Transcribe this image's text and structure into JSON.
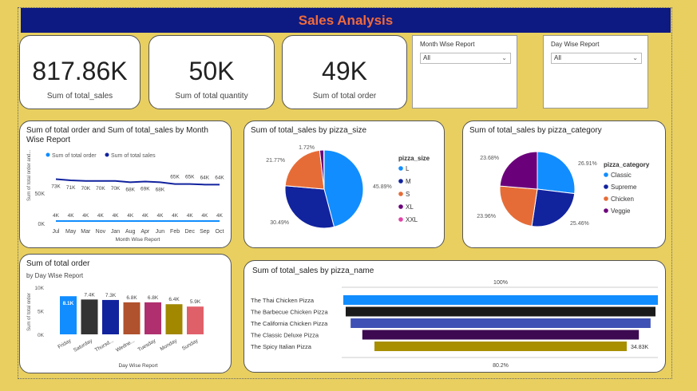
{
  "header": {
    "title": "Sales Analysis"
  },
  "kpis": [
    {
      "value": "817.86K",
      "label": "Sum of total_sales"
    },
    {
      "value": "50K",
      "label": "Sum of total quantity"
    },
    {
      "value": "49K",
      "label": "Sum of total order"
    }
  ],
  "slicers": [
    {
      "title": "Month Wise Report",
      "value": "All"
    },
    {
      "title": "Day Wise Report",
      "value": "All"
    }
  ],
  "colors": {
    "accent": "#118dff",
    "dark_blue": "#12239e",
    "orange": "#e66c37",
    "purple": "#6b007b",
    "pink": "#e044a7",
    "title_bg": "#0d1a82",
    "title_fg": "#f06a3c"
  },
  "chart_data": [
    {
      "id": "month_line",
      "type": "line",
      "title": "Sum of total order and Sum of total_sales by Month Wise Report",
      "xlabel": "Month Wise Report",
      "ylabel": "Sum of total order and...",
      "legend": [
        "Sum of total order",
        "Sum of total sales"
      ],
      "yticks": [
        "50K",
        "0K"
      ],
      "categories": [
        "Jul",
        "May",
        "Mar",
        "Nov",
        "Jan",
        "Aug",
        "Apr",
        "Jun",
        "Feb",
        "Dec",
        "Sep",
        "Oct"
      ],
      "series": [
        {
          "name": "Sum of total order",
          "values": [
            4,
            4,
            4,
            4,
            4,
            4,
            4,
            4,
            4,
            4,
            4,
            4
          ],
          "labels": [
            "4K",
            "4K",
            "4K",
            "4K",
            "4K",
            "4K",
            "4K",
            "4K",
            "4K",
            "4K",
            "4K",
            "4K"
          ]
        },
        {
          "name": "Sum of total sales",
          "values": [
            73,
            71,
            70,
            70,
            70,
            68,
            69,
            68,
            65,
            65,
            64,
            64
          ],
          "labels": [
            "73K",
            "71K",
            "70K",
            "70K",
            "70K",
            "68K",
            "69K",
            "68K",
            "65K",
            "65K",
            "64K",
            "64K"
          ]
        }
      ],
      "ylim": [
        0,
        100
      ]
    },
    {
      "id": "size_pie",
      "type": "pie",
      "title": "Sum of total_sales by pizza_size",
      "legend_title": "pizza_size",
      "categories": [
        "L",
        "M",
        "S",
        "XL",
        "XXL"
      ],
      "values": [
        45.89,
        30.49,
        21.77,
        1.72,
        0.12
      ],
      "labels": [
        "45.89%",
        "30.49%",
        "21.77%",
        "1.72%",
        ""
      ],
      "colors": [
        "#118dff",
        "#12239e",
        "#e66c37",
        "#6b007b",
        "#e044a7"
      ]
    },
    {
      "id": "category_pie",
      "type": "pie",
      "title": "Sum of total_sales by pizza_category",
      "legend_title": "pizza_category",
      "categories": [
        "Classic",
        "Supreme",
        "Chicken",
        "Veggie"
      ],
      "values": [
        26.91,
        25.46,
        23.96,
        23.68
      ],
      "labels": [
        "26.91%",
        "25.46%",
        "23.96%",
        "23.68%"
      ],
      "colors": [
        "#118dff",
        "#12239e",
        "#e66c37",
        "#6b007b"
      ]
    },
    {
      "id": "day_bar",
      "type": "bar",
      "title": "Sum of total order",
      "subtitle": "by Day Wise Report",
      "xlabel": "Day Wise Report",
      "ylabel": "Sum of total order",
      "yticks": [
        "10K",
        "5K",
        "0K"
      ],
      "categories": [
        "Friday",
        "Saturday",
        "Thursd...",
        "Wedne...",
        "Tuesday",
        "Monday",
        "Sunday"
      ],
      "values": [
        8.1,
        7.4,
        7.3,
        6.8,
        6.8,
        6.4,
        5.9
      ],
      "labels": [
        "8.1K",
        "7.4K",
        "7.3K",
        "6.8K",
        "6.8K",
        "6.4K",
        "5.9K"
      ],
      "colors": [
        "#118dff",
        "#333333",
        "#12239e",
        "#b0522d",
        "#b0306f",
        "#a18800",
        "#e0606a"
      ],
      "ylim": [
        0,
        10
      ]
    },
    {
      "id": "name_funnel",
      "type": "bar",
      "title": "Sum of total_sales by pizza_name",
      "categories": [
        "The Thai Chicken Pizza",
        "The Barbecue Chicken Pizza",
        "The California Chicken Pizza",
        "The Classic Deluxe Pizza",
        "The Spicy Italian Pizza"
      ],
      "values": [
        43.43,
        42.77,
        41.41,
        38.18,
        34.83
      ],
      "top_label": "100%",
      "bottom_label": "80.2%",
      "last_value_label": "34.83K",
      "colors": [
        "#118dff",
        "#1a1a1a",
        "#3f51b5",
        "#3d0a52",
        "#a88f00"
      ]
    }
  ]
}
